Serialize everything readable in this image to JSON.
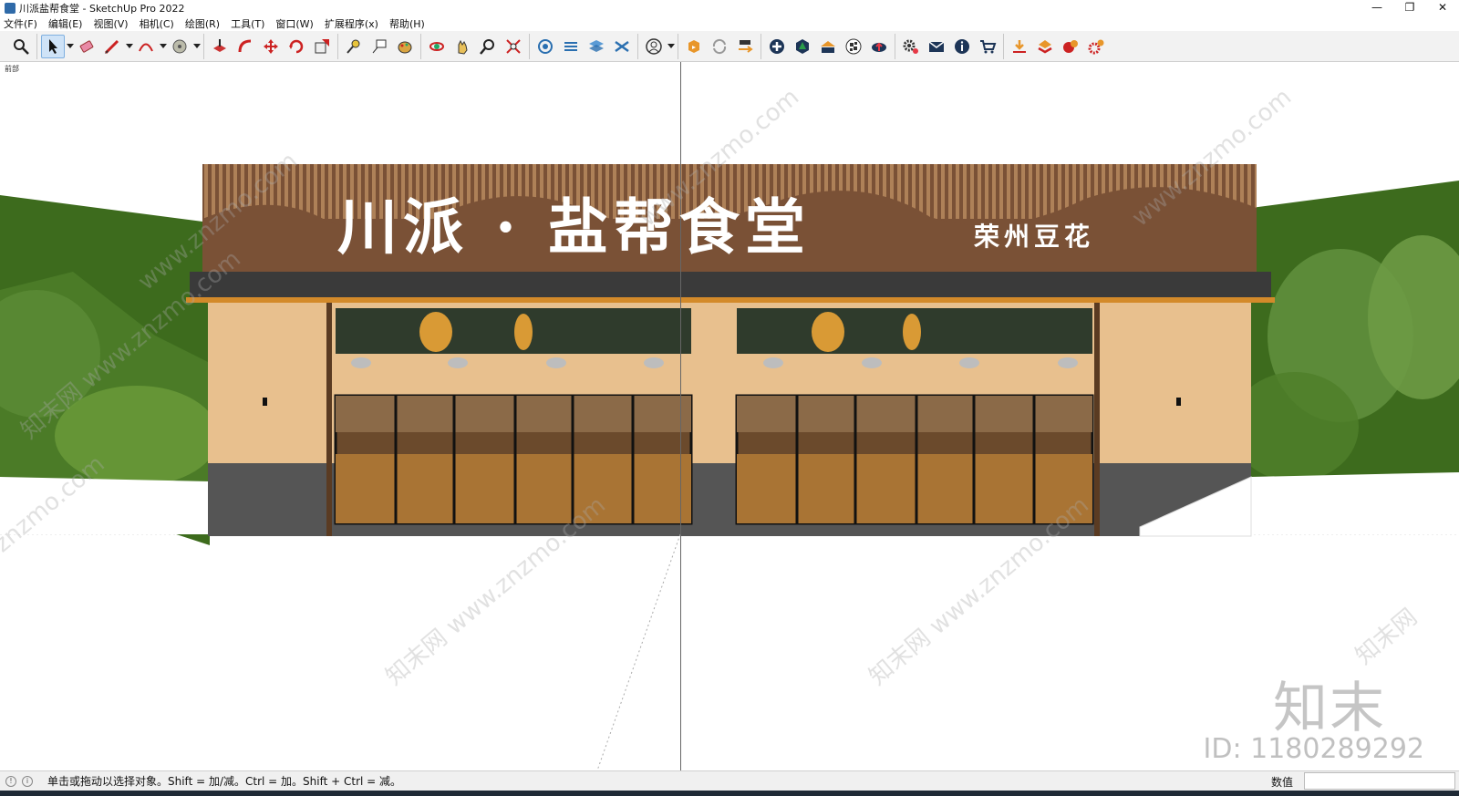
{
  "window": {
    "title": "川派盐帮食堂 - SketchUp Pro 2022",
    "controls": {
      "minimize": "—",
      "maximize": "❐",
      "close": "✕"
    }
  },
  "menu": [
    "文件(F)",
    "编辑(E)",
    "视图(V)",
    "相机(C)",
    "绘图(R)",
    "工具(T)",
    "窗口(W)",
    "扩展程序(x)",
    "帮助(H)"
  ],
  "toolbar": {
    "groups": [
      [
        "zoom-window-icon"
      ],
      [
        "select-icon",
        "eraser-icon",
        "pencil-icon",
        "arc-icon",
        "paint-bucket-icon"
      ],
      [
        "push-pull-icon",
        "follow-me-icon",
        "move-icon",
        "rotate-icon",
        "scale-icon"
      ],
      [
        "tape-measure-icon",
        "text-label-icon",
        "paint-icon"
      ],
      [
        "orbit-icon",
        "pan-icon",
        "zoom-icon",
        "zoom-extents-icon"
      ],
      [
        "warehouse-icon",
        "extension-icon",
        "layers-icon",
        "styles-icon"
      ],
      [
        "user-icon"
      ],
      [
        "sync-a-icon",
        "refresh-icon",
        "transfer-icon"
      ],
      [
        "plus-icon",
        "tree-icon",
        "roof-icon",
        "checker-icon",
        "cloud-icon"
      ],
      [
        "settings-icon",
        "mail-icon",
        "info-icon",
        "cart-icon"
      ],
      [
        "import-icon",
        "layer-up-icon",
        "plugin-a-icon",
        "plugin-b-icon"
      ]
    ],
    "active_tool": "select-icon"
  },
  "viewport": {
    "scene_label": "前部",
    "sign": {
      "main": "川派 · 盐帮食堂",
      "sub": "荣州豆花"
    },
    "watermarks": [
      "www.znzmo.com",
      "www.znzmo.com",
      "www.znzmo.com",
      "知末网 www.znzmo.com",
      "知末网 www.znzmo.com",
      "知末网 www.znzmo.com",
      "知末网",
      "znzmo.com"
    ],
    "brand_watermark": "知末",
    "id_watermark": "ID: 1180289292"
  },
  "statusbar": {
    "hint": "单击或拖动以选择对象。Shift = 加/减。Ctrl = 加。Shift + Ctrl = 减。",
    "measurements_label": "数值",
    "measurements_value": ""
  },
  "colors": {
    "toolbar_bg": "#f2f2f2",
    "sign_board": "#7a5136",
    "wall": "#e8c08e",
    "base": "#555555",
    "roof": "#3a3a3a",
    "grass": "#3f6f1c"
  }
}
